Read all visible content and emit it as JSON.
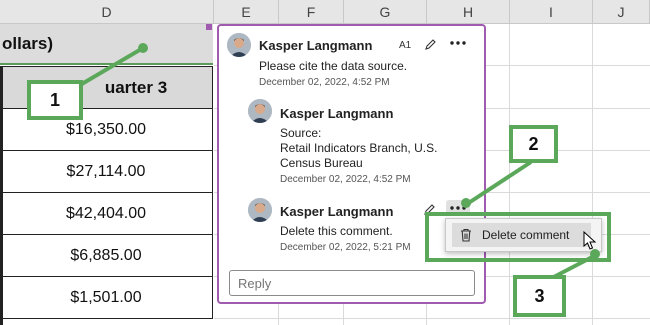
{
  "columns": [
    "D",
    "E",
    "F",
    "G",
    "H",
    "I",
    "J"
  ],
  "sheet": {
    "title_fragment": "ollars)",
    "header": "Quarter 3",
    "header_visible": "uarter 3",
    "values": [
      "$16,350.00",
      "$27,114.00",
      "$42,404.00",
      "$6,885.00",
      "$1,501.00"
    ]
  },
  "comments": {
    "cell_ref": "A1",
    "thread": [
      {
        "author": "Kasper Langmann",
        "text": "Please cite the data source.",
        "date": "December 02, 2022, 4:52 PM"
      },
      {
        "author": "Kasper Langmann",
        "text_lines": [
          "Source:",
          "Retail Indicators Branch, U.S.",
          "Census Bureau"
        ],
        "date": "December 02, 2022, 4:52 PM"
      },
      {
        "author": "Kasper Langmann",
        "text": "Delete this comment.",
        "date": "December 02, 2022, 5:21 PM"
      }
    ],
    "reply_placeholder": "Reply"
  },
  "context_menu": {
    "delete_label": "Delete comment"
  },
  "annotations": [
    "1",
    "2",
    "3"
  ],
  "colors": {
    "accent_green": "#5ba85b",
    "pane_border": "#a05ab0",
    "header_gray": "#d9d9d9"
  }
}
